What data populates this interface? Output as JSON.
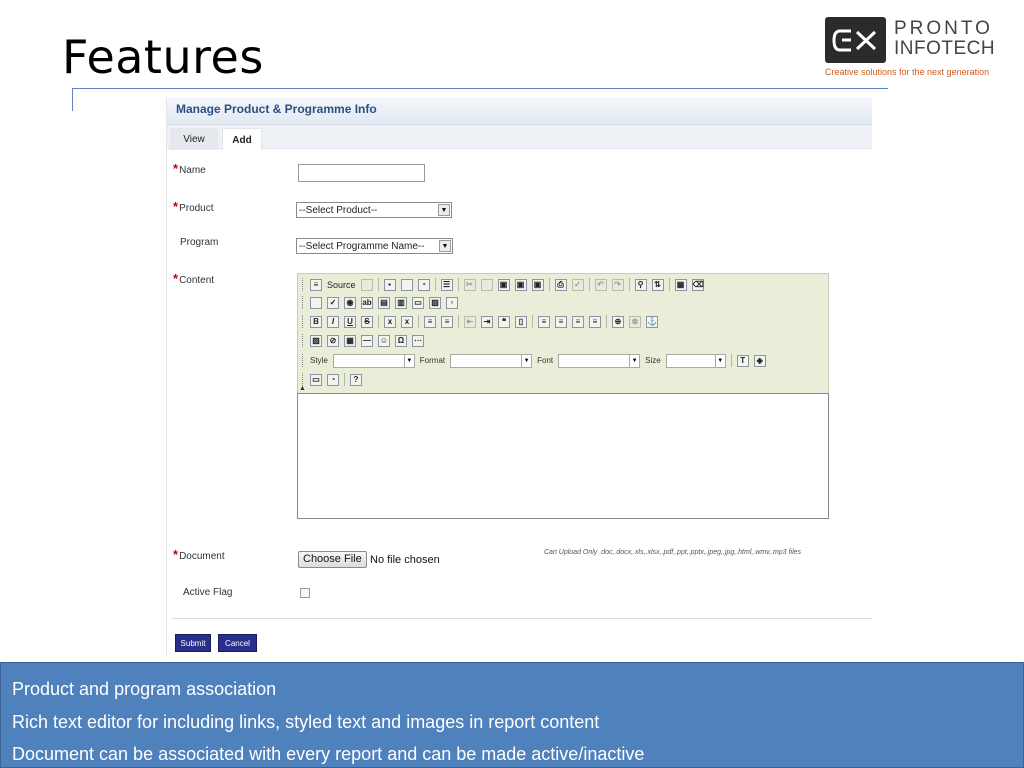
{
  "slide": {
    "title": "Features"
  },
  "logo": {
    "name_line1": "PRONTO",
    "name_line2": "INFOTECH",
    "tagline": "Creative solutions for the next generation"
  },
  "app": {
    "header": "Manage Product & Programme Info",
    "tabs": [
      "View",
      "Add"
    ],
    "active_tab": "Add",
    "form": {
      "required_mark": "*",
      "name_label": "Name",
      "product_label": "Product",
      "product_selected": "--Select Product--",
      "program_label": "Program",
      "program_selected": "--Select Programme Name--",
      "content_label": "Content",
      "document_label": "Document",
      "file_button": "Choose File",
      "file_status": "No file chosen",
      "file_hint": "Can Upload Only .doc,.docx,.xls,.xlsx,.pdf,.ppt,.pptx,.jpeg,.jpg,.html,.wmv,.mp3 files",
      "active_flag_label": "Active Flag",
      "active_flag_checked": false
    },
    "editor": {
      "source_label": "Source",
      "style_label": "Style",
      "format_label": "Format",
      "font_label": "Font",
      "size_label": "Size"
    },
    "buttons": {
      "submit": "Submit",
      "cancel": "Cancel"
    }
  },
  "caption": {
    "lines": [
      "Product and program association",
      "Rich text editor for including links, styled text and images in report content",
      "Document can be associated with every report and can be made active/inactive"
    ]
  },
  "colors": {
    "accent": "#4f81bd",
    "brand_orange": "#d55a1a",
    "button": "#2b2f8c",
    "required": "#cc0000"
  }
}
